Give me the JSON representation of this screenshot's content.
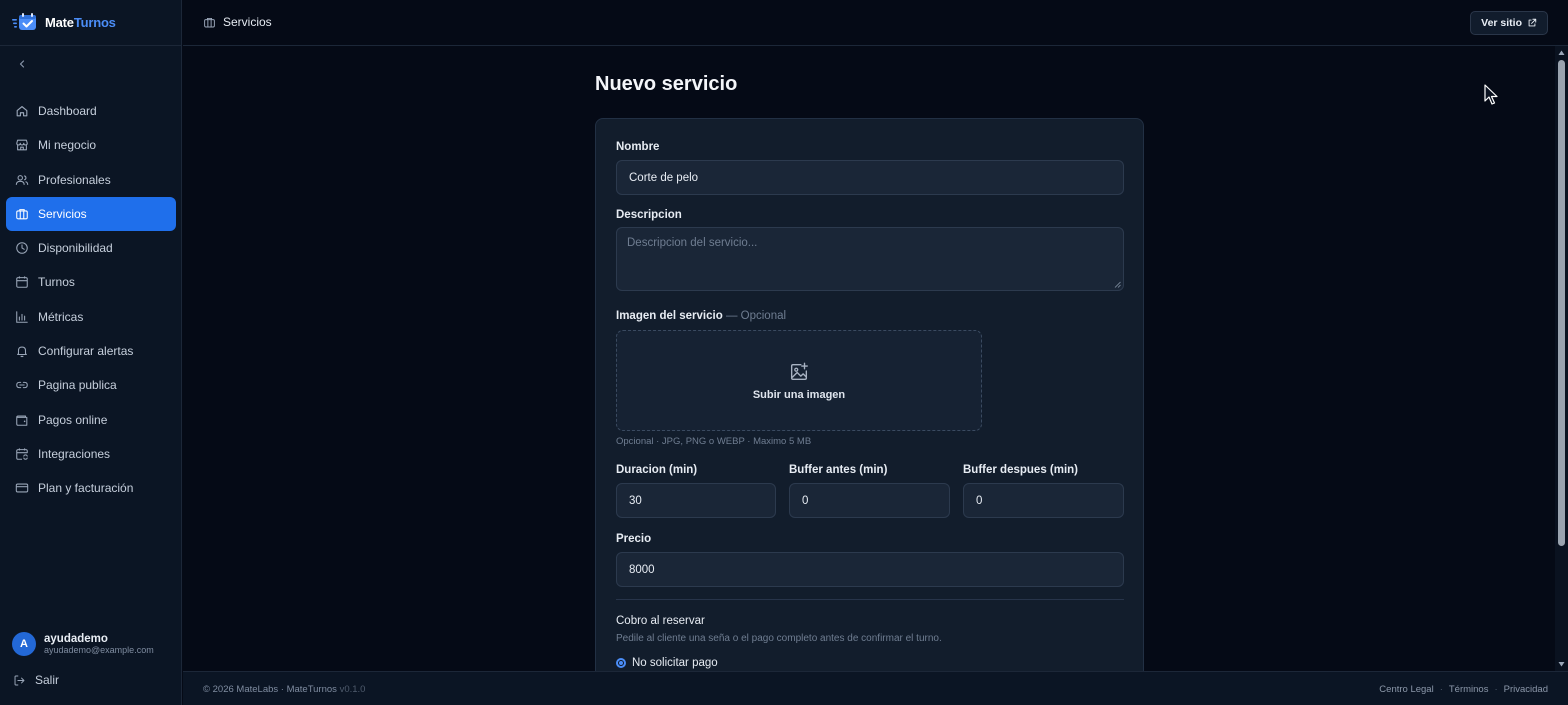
{
  "app": {
    "brand_main": "Mate",
    "brand_accent": "Turnos"
  },
  "sidebar": {
    "items": [
      {
        "label": "Dashboard",
        "icon": "home-icon"
      },
      {
        "label": "Mi negocio",
        "icon": "store-icon"
      },
      {
        "label": "Profesionales",
        "icon": "users-icon"
      },
      {
        "label": "Servicios",
        "icon": "briefcase-icon",
        "active": true
      },
      {
        "label": "Disponibilidad",
        "icon": "clock-icon"
      },
      {
        "label": "Turnos",
        "icon": "calendar-icon"
      },
      {
        "label": "Métricas",
        "icon": "bar-chart-icon"
      },
      {
        "label": "Configurar alertas",
        "icon": "bell-icon"
      },
      {
        "label": "Pagina publica",
        "icon": "link-icon"
      },
      {
        "label": "Pagos online",
        "icon": "wallet-icon"
      },
      {
        "label": "Integraciones",
        "icon": "calendar-sync-icon"
      },
      {
        "label": "Plan y facturación",
        "icon": "credit-card-icon"
      }
    ],
    "user": {
      "initial": "A",
      "name": "ayudademo",
      "email": "ayudademo@example.com"
    },
    "logout_label": "Salir"
  },
  "header": {
    "breadcrumb": "Servicios",
    "view_site_label": "Ver sitio"
  },
  "main": {
    "title": "Nuevo servicio",
    "form": {
      "name_label": "Nombre",
      "name_value": "Corte de pelo",
      "description_label": "Descripcion",
      "description_placeholder": "Descripcion del servicio...",
      "image_label": "Imagen del servicio",
      "image_optional": "— Opcional",
      "upload_label": "Subir una imagen",
      "upload_hint": "Opcional · JPG, PNG o WEBP · Maximo 5 MB",
      "duration_label": "Duracion (min)",
      "duration_value": "30",
      "buffer_before_label": "Buffer antes (min)",
      "buffer_before_value": "0",
      "buffer_after_label": "Buffer despues (min)",
      "buffer_after_value": "0",
      "price_label": "Precio",
      "price_value": "8000",
      "charge_title": "Cobro al reservar",
      "charge_description": "Pedile al cliente una seña o el pago completo antes de confirmar el turno.",
      "charge_option_none": "No solicitar pago"
    }
  },
  "footer": {
    "copyright": "© 2026 MateLabs · MateTurnos",
    "version": "v0.1.0",
    "links": [
      "Centro Legal",
      "Términos",
      "Privacidad"
    ]
  },
  "colors": {
    "accent": "#1f6feb",
    "background": "#050a16",
    "sidebar": "#0b1524",
    "card": "#121d2c"
  }
}
